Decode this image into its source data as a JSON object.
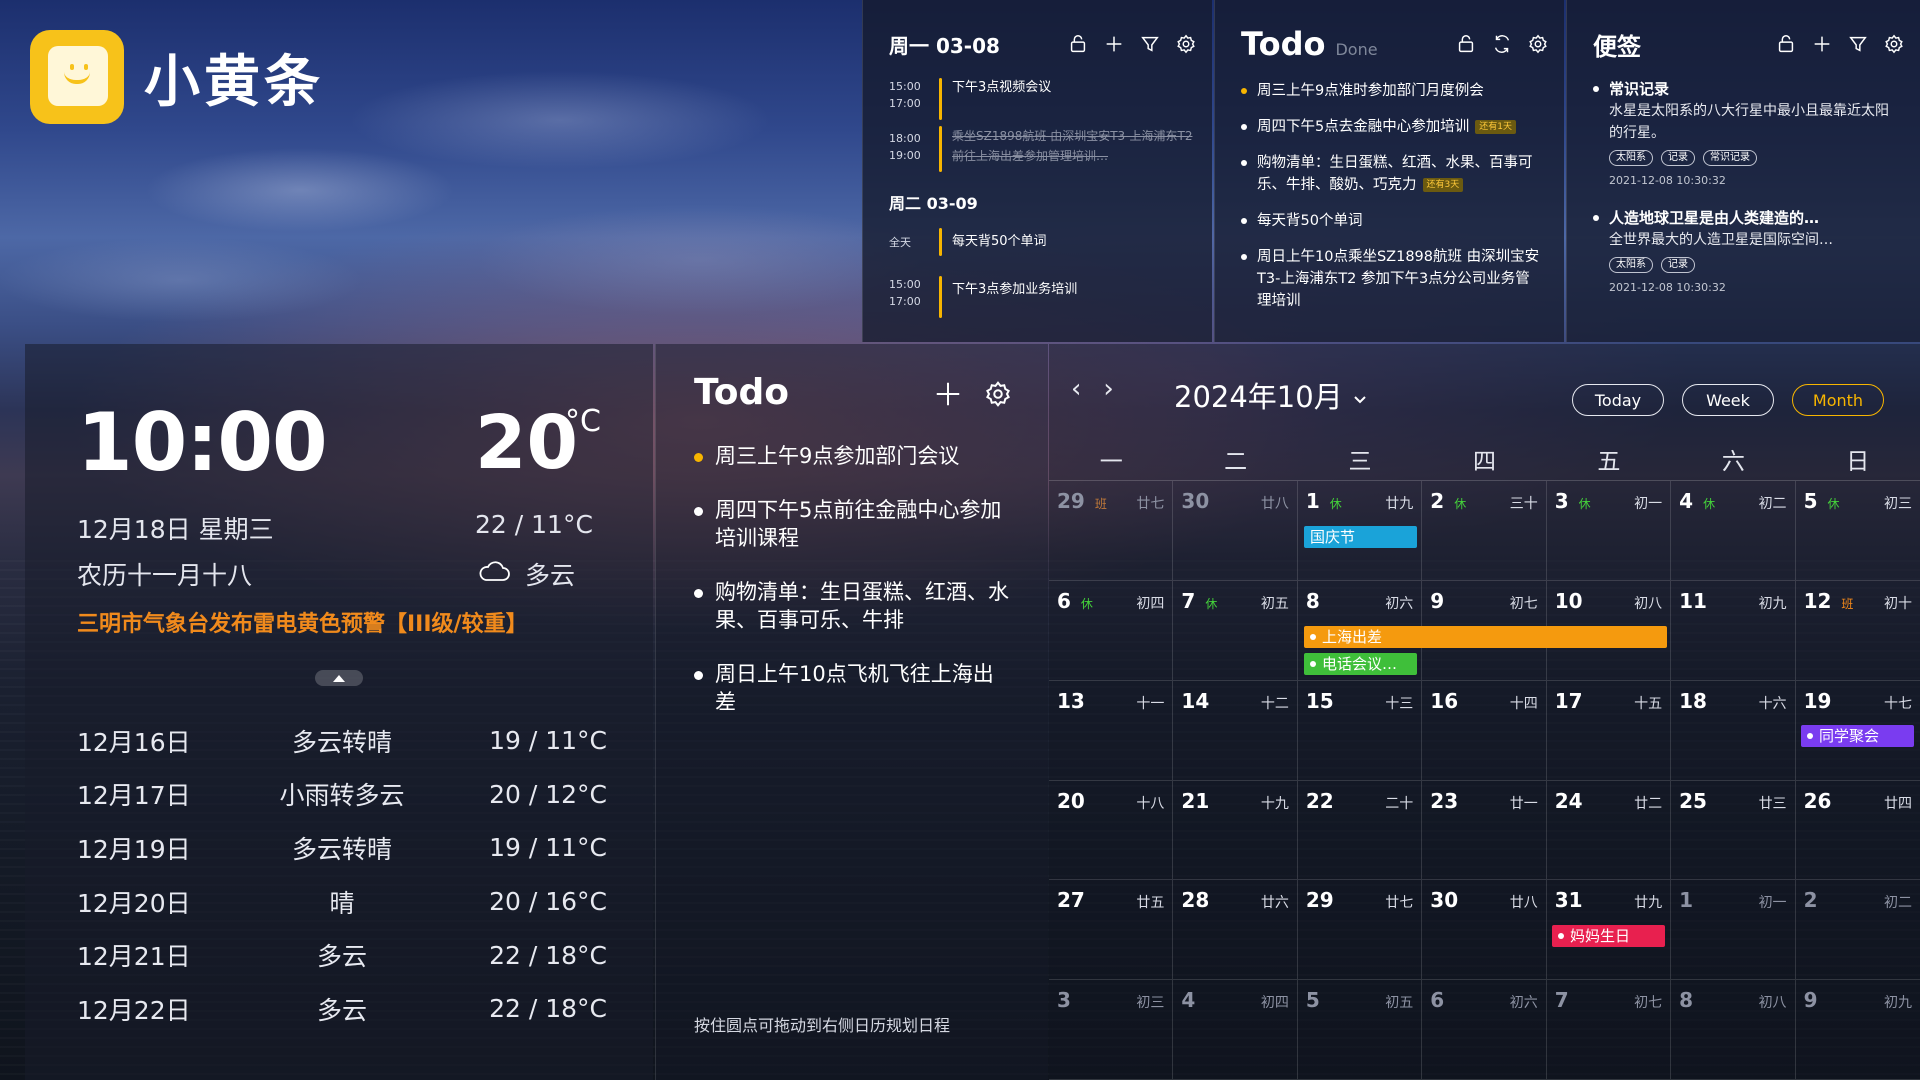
{
  "app": {
    "name": "小黄条"
  },
  "schedule": {
    "days": [
      {
        "label": "周一  03-08",
        "items": [
          {
            "time": "15:00\n17:00",
            "text": "下午3点视频会议",
            "done": false
          },
          {
            "time": "18:00\n19:00",
            "text": "乘坐SZ1898航班 由深圳宝安T3-上海浦东T2 前往上海出差参加管理培训…",
            "done": true
          }
        ]
      },
      {
        "label": "周二  03-09",
        "items": [
          {
            "time": "全天",
            "text": "每天背50个单词",
            "done": false
          },
          {
            "time": "15:00\n17:00",
            "text": "下午3点参加业务培训",
            "done": false
          }
        ]
      }
    ]
  },
  "todo_top": {
    "title": "Todo",
    "subtitle": "Done",
    "items": [
      {
        "text": "周三上午9点准时参加部门月度例会",
        "tag": "",
        "highlight": true
      },
      {
        "text": "周四下午5点去金融中心参加培训",
        "tag": "还有1天",
        "highlight": false
      },
      {
        "text": "购物清单：生日蛋糕、红酒、水果、百事可乐、牛排、酸奶、巧克力",
        "tag": "还有3天",
        "highlight": false
      },
      {
        "text": "每天背50个单词",
        "tag": "",
        "highlight": false
      },
      {
        "text": "周日上午10点乘坐SZ1898航班 由深圳宝安T3-上海浦东T2 参加下午3点分公司业务管理培训",
        "tag": "",
        "highlight": false
      }
    ]
  },
  "notes": {
    "title": "便签",
    "items": [
      {
        "title": "常识记录",
        "body": "水星是太阳系的八大行星中最小且最靠近太阳的行星。",
        "tags": [
          "太阳系",
          "记录",
          "常识记录"
        ],
        "time": "2021-12-08 10:30:32"
      },
      {
        "title": "人造地球卫星是由人类建造的…",
        "body": "全世界最大的人造卫星是国际空间…",
        "tags": [
          "太阳系",
          "记录"
        ],
        "time": "2021-12-08 10:30:32"
      }
    ]
  },
  "weather": {
    "time": "10:00",
    "temp": "20",
    "unit": "°C",
    "date": "12月18日  星期三",
    "range": "22 / 11°C",
    "lunar": "农历十一月十八",
    "condition": "多云",
    "warning": "三明市气象台发布雷电黄色预警【III级/较重】",
    "forecast": [
      {
        "date": "12月16日",
        "cond": "多云转晴",
        "temp": "19 / 11°C"
      },
      {
        "date": "12月17日",
        "cond": "小雨转多云",
        "temp": "20 / 12°C"
      },
      {
        "date": "12月19日",
        "cond": "多云转晴",
        "temp": "19 / 11°C"
      },
      {
        "date": "12月20日",
        "cond": "晴",
        "temp": "20 / 16°C"
      },
      {
        "date": "12月21日",
        "cond": "多云",
        "temp": "22 / 18°C"
      },
      {
        "date": "12月22日",
        "cond": "多云",
        "temp": "22 / 18°C"
      }
    ]
  },
  "todo_main": {
    "title": "Todo",
    "items": [
      {
        "text": "周三上午9点参加部门会议",
        "highlight": true
      },
      {
        "text": "周四下午5点前往金融中心参加培训课程",
        "highlight": false
      },
      {
        "text": "购物清单：生日蛋糕、红酒、水果、百事可乐、牛排",
        "highlight": false
      },
      {
        "text": "周日上午10点飞机飞往上海出差",
        "highlight": false
      }
    ],
    "hint": "按住圆点可拖动到右侧日历规划日程"
  },
  "calendar": {
    "month_label": "2024年10月",
    "buttons": [
      "Today",
      "Week",
      "Month"
    ],
    "active_button": "Month",
    "weekdays": [
      "一",
      "二",
      "三",
      "四",
      "五",
      "六",
      "日"
    ],
    "badge_labels": {
      "rest": "休",
      "work": "班"
    },
    "cells": [
      {
        "d": "29",
        "l": "廿七",
        "b": "work",
        "o": true
      },
      {
        "d": "30",
        "l": "廿八",
        "b": "",
        "o": true
      },
      {
        "d": "1",
        "l": "廿九",
        "b": "rest",
        "o": false
      },
      {
        "d": "2",
        "l": "三十",
        "b": "rest",
        "o": false
      },
      {
        "d": "3",
        "l": "初一",
        "b": "rest",
        "o": false
      },
      {
        "d": "4",
        "l": "初二",
        "b": "rest",
        "o": false
      },
      {
        "d": "5",
        "l": "初三",
        "b": "rest",
        "o": false
      },
      {
        "d": "6",
        "l": "初四",
        "b": "rest",
        "o": false
      },
      {
        "d": "7",
        "l": "初五",
        "b": "rest",
        "o": false
      },
      {
        "d": "8",
        "l": "初六",
        "b": "",
        "o": false
      },
      {
        "d": "9",
        "l": "初七",
        "b": "",
        "o": false
      },
      {
        "d": "10",
        "l": "初八",
        "b": "",
        "o": false
      },
      {
        "d": "11",
        "l": "初九",
        "b": "",
        "o": false
      },
      {
        "d": "12",
        "l": "初十",
        "b": "work",
        "o": false
      },
      {
        "d": "13",
        "l": "十一",
        "b": "",
        "o": false
      },
      {
        "d": "14",
        "l": "十二",
        "b": "",
        "o": false
      },
      {
        "d": "15",
        "l": "十三",
        "b": "",
        "o": false
      },
      {
        "d": "16",
        "l": "十四",
        "b": "",
        "o": false
      },
      {
        "d": "17",
        "l": "十五",
        "b": "",
        "o": false
      },
      {
        "d": "18",
        "l": "十六",
        "b": "",
        "o": false
      },
      {
        "d": "19",
        "l": "十七",
        "b": "",
        "o": false
      },
      {
        "d": "20",
        "l": "十八",
        "b": "",
        "o": false
      },
      {
        "d": "21",
        "l": "十九",
        "b": "",
        "o": false
      },
      {
        "d": "22",
        "l": "二十",
        "b": "",
        "o": false
      },
      {
        "d": "23",
        "l": "廿一",
        "b": "",
        "o": false
      },
      {
        "d": "24",
        "l": "廿二",
        "b": "",
        "o": false
      },
      {
        "d": "25",
        "l": "廿三",
        "b": "",
        "o": false
      },
      {
        "d": "26",
        "l": "廿四",
        "b": "",
        "o": false
      },
      {
        "d": "27",
        "l": "廿五",
        "b": "",
        "o": false
      },
      {
        "d": "28",
        "l": "廿六",
        "b": "",
        "o": false
      },
      {
        "d": "29",
        "l": "廿七",
        "b": "",
        "o": false
      },
      {
        "d": "30",
        "l": "廿八",
        "b": "",
        "o": false
      },
      {
        "d": "31",
        "l": "廿九",
        "b": "",
        "o": false
      },
      {
        "d": "1",
        "l": "初一",
        "b": "",
        "o": true
      },
      {
        "d": "2",
        "l": "初二",
        "b": "",
        "o": true
      },
      {
        "d": "3",
        "l": "初三",
        "b": "",
        "o": true
      },
      {
        "d": "4",
        "l": "初四",
        "b": "",
        "o": true
      },
      {
        "d": "5",
        "l": "初五",
        "b": "",
        "o": true
      },
      {
        "d": "6",
        "l": "初六",
        "b": "",
        "o": true
      },
      {
        "d": "7",
        "l": "初七",
        "b": "",
        "o": true
      },
      {
        "d": "8",
        "l": "初八",
        "b": "",
        "o": true
      },
      {
        "d": "9",
        "l": "初九",
        "b": "",
        "o": true
      }
    ],
    "events": [
      {
        "text": "国庆节",
        "color": "#1aa3d9",
        "dot": false
      },
      {
        "text": "上海出差",
        "color": "#f59a0e",
        "dot": true
      },
      {
        "text": "电话会议…",
        "color": "#3fbf3a",
        "dot": true
      },
      {
        "text": "同学聚会",
        "color": "#7a3cf0",
        "dot": true
      },
      {
        "text": "妈妈生日",
        "color": "#e8204f",
        "dot": true
      }
    ]
  },
  "colors": {
    "accent": "#f7b500",
    "warning": "#f08a1c",
    "rest": "#44d23a",
    "work": "#f58a1a"
  }
}
